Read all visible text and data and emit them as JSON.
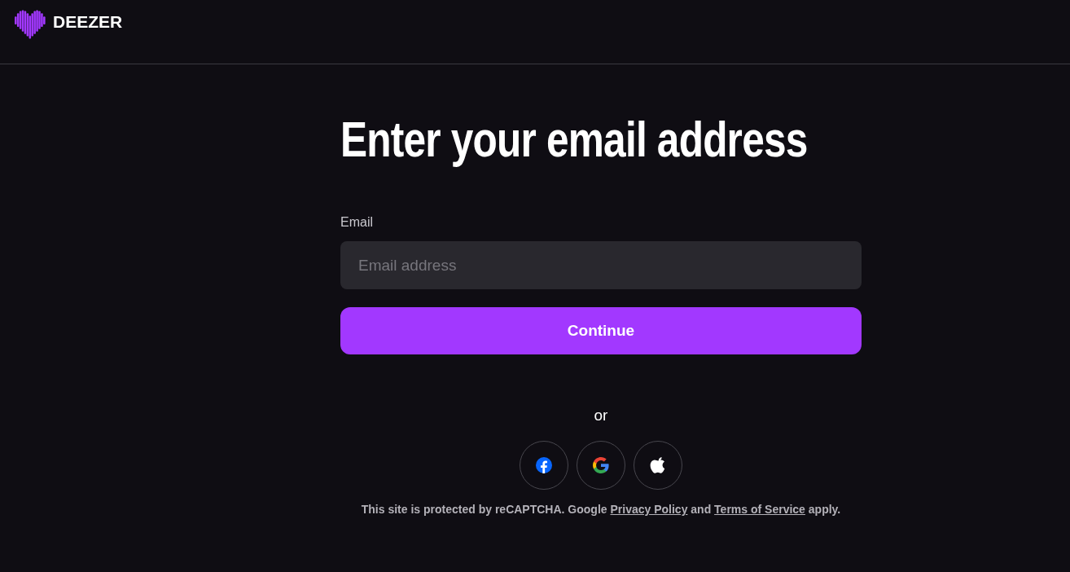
{
  "header": {
    "logo_text": "DEEZER"
  },
  "title": "Enter your email address",
  "email_field": {
    "label": "Email",
    "placeholder": "Email address"
  },
  "continue_button": "Continue",
  "divider_text": "or",
  "social_buttons": [
    {
      "kind": "facebook"
    },
    {
      "kind": "google"
    },
    {
      "kind": "apple"
    }
  ],
  "recaptcha_notice": [
    {
      "kind": "text",
      "text": "This site is protected by reCAPTCHA. Google "
    },
    {
      "kind": "link",
      "text": "Privacy Policy"
    },
    {
      "kind": "text",
      "text": " and "
    },
    {
      "kind": "link",
      "text": "Terms of Service"
    },
    {
      "kind": "text",
      "text": " apply."
    }
  ]
}
